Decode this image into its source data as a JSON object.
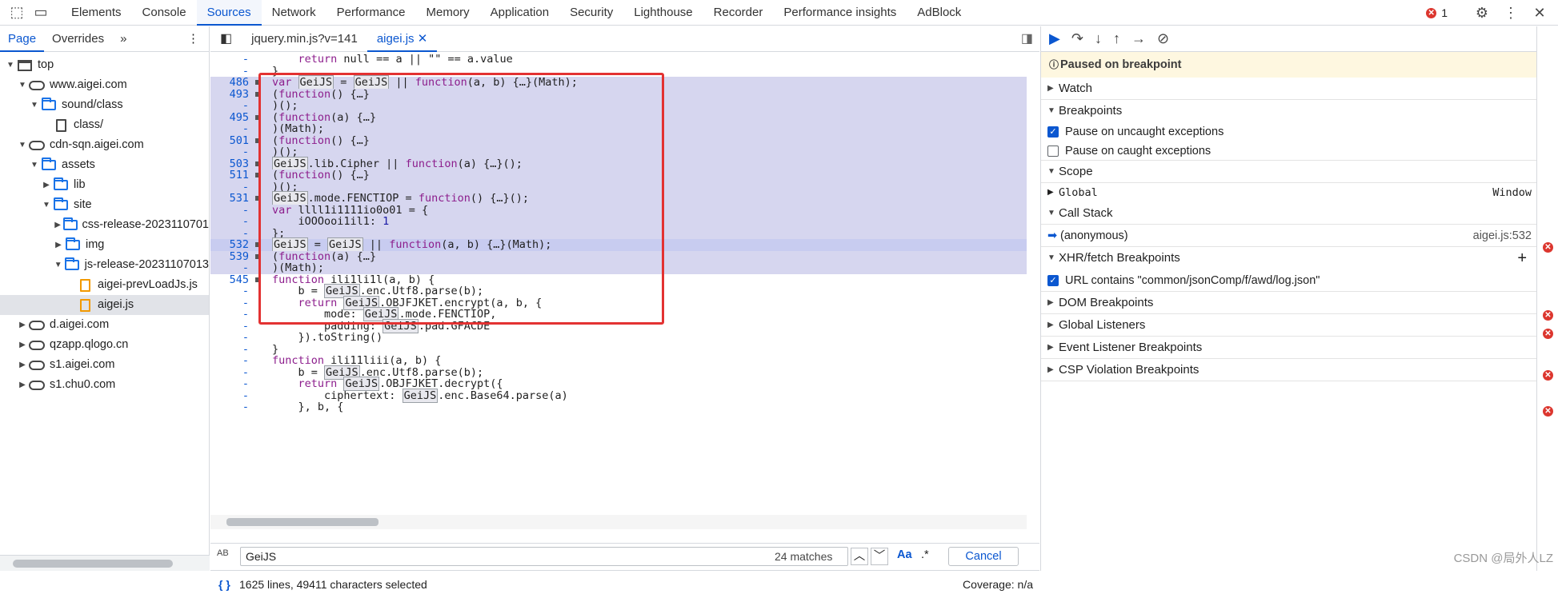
{
  "topbar": {
    "tabs": [
      "Elements",
      "Console",
      "Sources",
      "Network",
      "Performance",
      "Memory",
      "Application",
      "Security",
      "Lighthouse",
      "Recorder",
      "Performance insights",
      "AdBlock"
    ],
    "error_count": "1"
  },
  "left": {
    "subtabs": [
      "Page",
      "Overrides"
    ],
    "tree": [
      {
        "label": "top",
        "level": 0,
        "icon": "page",
        "arrow": "down"
      },
      {
        "label": "www.aigei.com",
        "level": 1,
        "icon": "cloud",
        "arrow": "down"
      },
      {
        "label": "sound/class",
        "level": 2,
        "icon": "folder",
        "arrow": "down"
      },
      {
        "label": "class/",
        "level": 3,
        "icon": "file",
        "arrow": ""
      },
      {
        "label": "cdn-sqn.aigei.com",
        "level": 1,
        "icon": "cloud",
        "arrow": "down"
      },
      {
        "label": "assets",
        "level": 2,
        "icon": "folder",
        "arrow": "down"
      },
      {
        "label": "lib",
        "level": 3,
        "icon": "folder",
        "arrow": "right"
      },
      {
        "label": "site",
        "level": 3,
        "icon": "folder",
        "arrow": "down"
      },
      {
        "label": "css-release-2023110701",
        "level": 4,
        "icon": "folder",
        "arrow": "right"
      },
      {
        "label": "img",
        "level": 4,
        "icon": "folder",
        "arrow": "right"
      },
      {
        "label": "js-release-20231107013",
        "level": 4,
        "icon": "folder",
        "arrow": "down"
      },
      {
        "label": "aigei-prevLoadJs.js",
        "level": 5,
        "icon": "js",
        "arrow": ""
      },
      {
        "label": "aigei.js",
        "level": 5,
        "icon": "js",
        "arrow": "",
        "selected": true
      },
      {
        "label": "d.aigei.com",
        "level": 1,
        "icon": "cloud",
        "arrow": "right"
      },
      {
        "label": "qzapp.qlogo.cn",
        "level": 1,
        "icon": "cloud",
        "arrow": "right"
      },
      {
        "label": "s1.aigei.com",
        "level": 1,
        "icon": "cloud",
        "arrow": "right"
      },
      {
        "label": "s1.chu0.com",
        "level": 1,
        "icon": "cloud",
        "arrow": "right"
      }
    ]
  },
  "editor": {
    "file_tabs": [
      "jquery.min.js?v=141",
      "aigei.js"
    ],
    "lines": [
      {
        "n": "-",
        "t": "    return null == a || \"\" == a.value"
      },
      {
        "n": "-",
        "t": "}"
      },
      {
        "n": "486",
        "t": "var GeiJS = GeiJS || function(a, b) {…}(Math);",
        "sel": true
      },
      {
        "n": "493",
        "t": "(function() {…}",
        "sel": true
      },
      {
        "n": "-",
        "t": ")();",
        "sel": true
      },
      {
        "n": "495",
        "t": "(function(a) {…}",
        "sel": true
      },
      {
        "n": "-",
        "t": ")(Math);",
        "sel": true
      },
      {
        "n": "501",
        "t": "(function() {…}",
        "sel": true
      },
      {
        "n": "-",
        "t": ")();",
        "sel": true
      },
      {
        "n": "503",
        "t": "GeiJS.lib.Cipher || function(a) {…}();",
        "sel": true
      },
      {
        "n": "511",
        "t": "(function() {…}",
        "sel": true
      },
      {
        "n": "-",
        "t": ")();",
        "sel": true
      },
      {
        "n": "531",
        "t": "GeiJS.mode.FENCTIOP = function() {…}();",
        "sel": true
      },
      {
        "n": "-",
        "t": "var llll1i1111io0o01 = {",
        "sel": true
      },
      {
        "n": "-",
        "t": "    iOOOooi1il1: 1",
        "sel": true
      },
      {
        "n": "-",
        "t": "};",
        "sel": true
      },
      {
        "n": "532",
        "t": "GeiJS = GeiJS || function(a, b) {…}(Math);",
        "sel": true,
        "cur": true
      },
      {
        "n": "539",
        "t": "(function(a) {…}",
        "sel": true
      },
      {
        "n": "-",
        "t": ")(Math);",
        "sel": true
      },
      {
        "n": "545",
        "t": "function ili1li1l(a, b) {"
      },
      {
        "n": "-",
        "t": "    b = GeiJS.enc.Utf8.parse(b);"
      },
      {
        "n": "-",
        "t": "    return GeiJS.OBJFJKET.encrypt(a, b, {"
      },
      {
        "n": "-",
        "t": "        mode: GeiJS.mode.FENCTIOP,"
      },
      {
        "n": "-",
        "t": "        padding: GeiJS.pad.GFACDE"
      },
      {
        "n": "-",
        "t": "    }).toString()"
      },
      {
        "n": "-",
        "t": "}"
      },
      {
        "n": "-",
        "t": "function ili11liii(a, b) {"
      },
      {
        "n": "-",
        "t": "    b = GeiJS.enc.Utf8.parse(b);"
      },
      {
        "n": "-",
        "t": "    return GeiJS.OBJFJKET.decrypt({"
      },
      {
        "n": "-",
        "t": "        ciphertext: GeiJS.enc.Base64.parse(a)"
      },
      {
        "n": "-",
        "t": "    }, b, {"
      }
    ]
  },
  "search": {
    "query": "GeiJS",
    "matches": "24 matches",
    "case_label": "Aa",
    "regex_label": ".*",
    "cancel_label": "Cancel"
  },
  "status": {
    "selection": "1625 lines, 49411 characters selected",
    "coverage": "Coverage: n/a"
  },
  "debugger": {
    "paused": "Paused on breakpoint",
    "watch": "Watch",
    "breakpoints": "Breakpoints",
    "pause_uncaught": "Pause on uncaught exceptions",
    "pause_caught": "Pause on caught exceptions",
    "scope": "Scope",
    "global": "Global",
    "window": "Window",
    "call_stack": "Call Stack",
    "frame_name": "(anonymous)",
    "frame_loc": "aigei.js:532",
    "xhr": "XHR/fetch Breakpoints",
    "xhr_item": "URL contains \"common/jsonComp/f/awd/log.json\"",
    "dom": "DOM Breakpoints",
    "global_listeners": "Global Listeners",
    "event_listener": "Event Listener Breakpoints",
    "csp": "CSP Violation Breakpoints"
  },
  "watermark": "CSDN @局外人LZ"
}
